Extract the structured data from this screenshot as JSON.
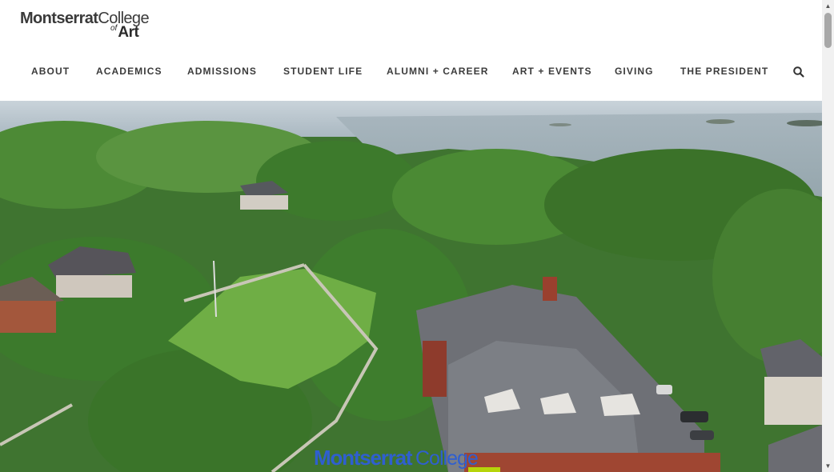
{
  "logo": {
    "line1_bold": "Montserrat",
    "line1_regular": "College",
    "line2_small": "of",
    "line2_bold": "Art"
  },
  "nav": {
    "items": [
      {
        "label": "ABOUT"
      },
      {
        "label": "ACADEMICS"
      },
      {
        "label": "ADMISSIONS"
      },
      {
        "label": "STUDENT LIFE"
      },
      {
        "label": "ALUMNI + CAREER"
      },
      {
        "label": "ART + EVENTS"
      },
      {
        "label": "GIVING"
      },
      {
        "label": "THE PRESIDENT"
      }
    ],
    "search_icon": "search-icon"
  },
  "hero": {
    "overlay_logo_bold": "Montserrat",
    "overlay_logo_regular": "College",
    "colors": {
      "overlay_blue": "#2f5fd0",
      "overlay_green": "#b6d40a"
    }
  },
  "scrollbar": {
    "up_icon": "scroll-up-arrow",
    "down_icon": "scroll-down-arrow"
  },
  "colors": {
    "nav_text": "#3b3b3b",
    "background": "#ffffff"
  }
}
